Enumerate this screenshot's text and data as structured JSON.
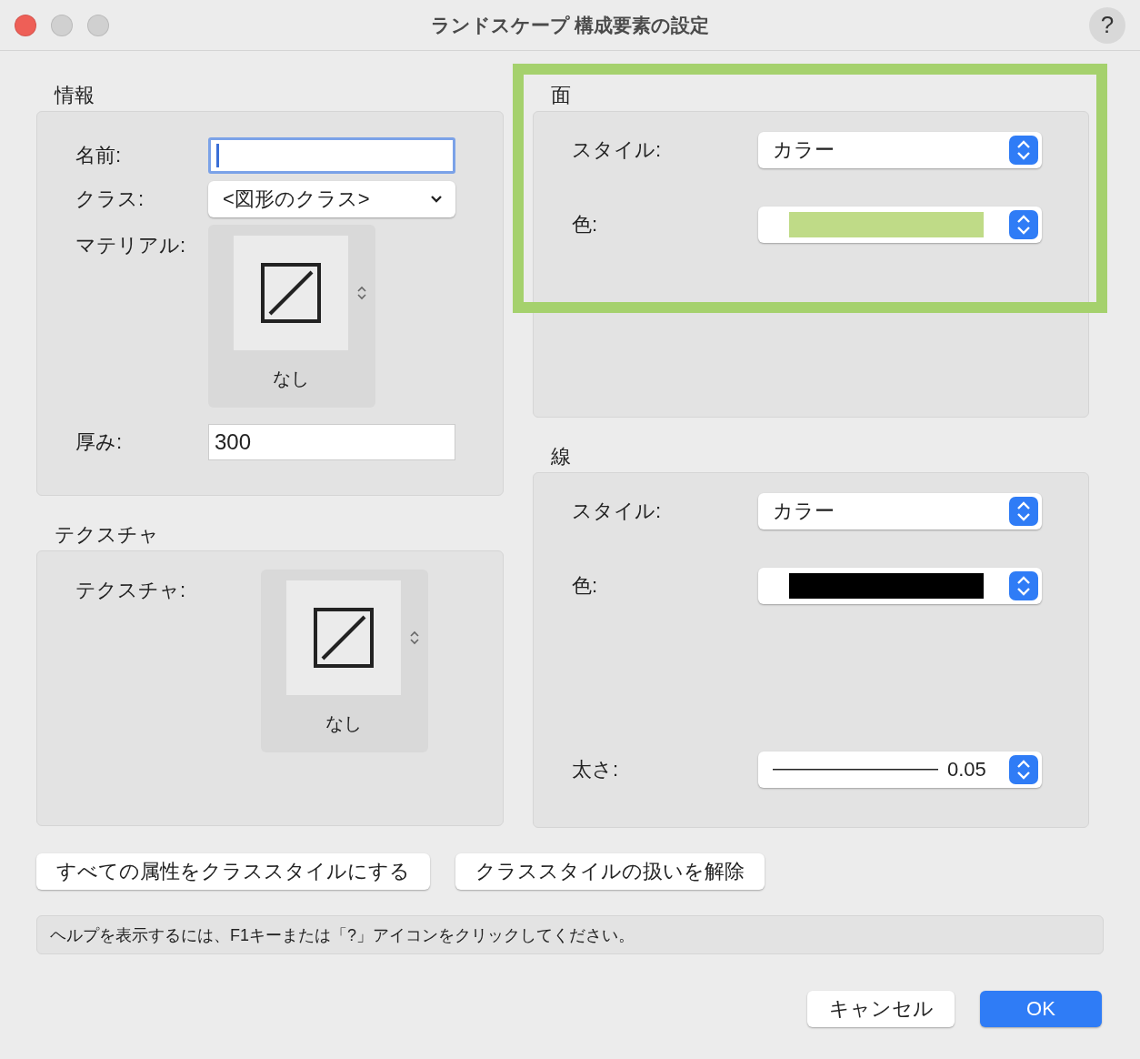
{
  "window": {
    "title": "ランドスケープ 構成要素の設定",
    "help": "?"
  },
  "info": {
    "heading": "情報",
    "name_label": "名前:",
    "name_focused": true,
    "class_label": "クラス:",
    "class_value": "<図形のクラス>",
    "material_label": "マテリアル:",
    "material_caption": "なし",
    "thickness_label": "厚み:",
    "thickness_value": "300"
  },
  "texture": {
    "heading": "テクスチャ",
    "label": "テクスチャ:",
    "caption": "なし"
  },
  "face": {
    "heading": "面",
    "highlighted": true,
    "style_label": "スタイル:",
    "style_value": "カラー",
    "color_label": "色:",
    "color": "#bfdb87"
  },
  "line": {
    "heading": "線",
    "style_label": "スタイル:",
    "style_value": "カラー",
    "color_label": "色:",
    "color": "#000000",
    "weight_label": "太さ:",
    "weight_value": "0.05"
  },
  "buttons": [
    "すべての属性をクラススタイルにする",
    "クラススタイルの扱いを解除"
  ],
  "help_text": "ヘルプを表示するには、F1キーまたは「?」アイコンをクリックしてください。",
  "footer_buttons": [
    {
      "label": "キャンセル",
      "kind": "secondary"
    },
    {
      "label": "OK",
      "kind": "primary"
    }
  ]
}
